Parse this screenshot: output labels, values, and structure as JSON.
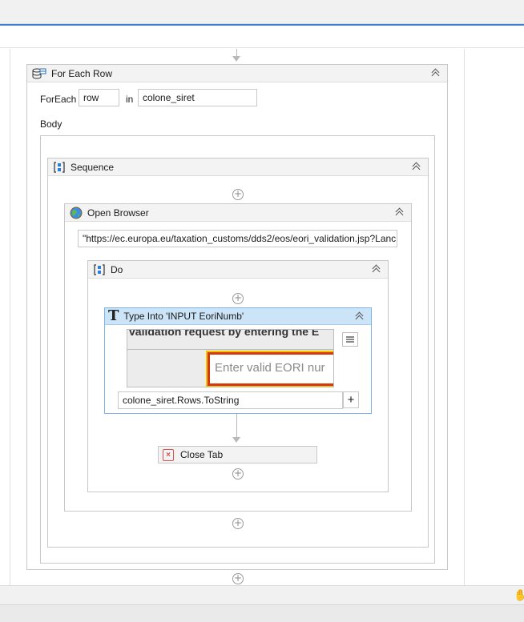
{
  "foreach": {
    "title": "For Each Row",
    "foreach_label": "ForEach",
    "item_var": "row",
    "in_label": "in",
    "collection": "colone_siret",
    "body_label": "Body"
  },
  "sequence": {
    "title": "Sequence"
  },
  "open_browser": {
    "title": "Open Browser",
    "url": "\"https://ec.europa.eu/taxation_customs/dds2/eos/eori_validation.jsp?Lanc"
  },
  "do": {
    "title": "Do"
  },
  "type_into": {
    "title": "Type Into 'INPUT  EoriNumb'",
    "preview_top_text": "validation request by entering the E",
    "preview_input_placeholder": "Enter valid EORI nur",
    "text_value": "colone_siret.Rows.ToString",
    "plus_label": "+"
  },
  "close_tab": {
    "title": "Close Tab"
  },
  "icons": {
    "collapse": "double-chevron-up-icon",
    "add": "plus-circle-icon",
    "hand": "hand-icon"
  },
  "colors": {
    "accent": "#3b7fd1",
    "type_into_header": "#cce4f7",
    "preview_border": "#d4380d"
  }
}
